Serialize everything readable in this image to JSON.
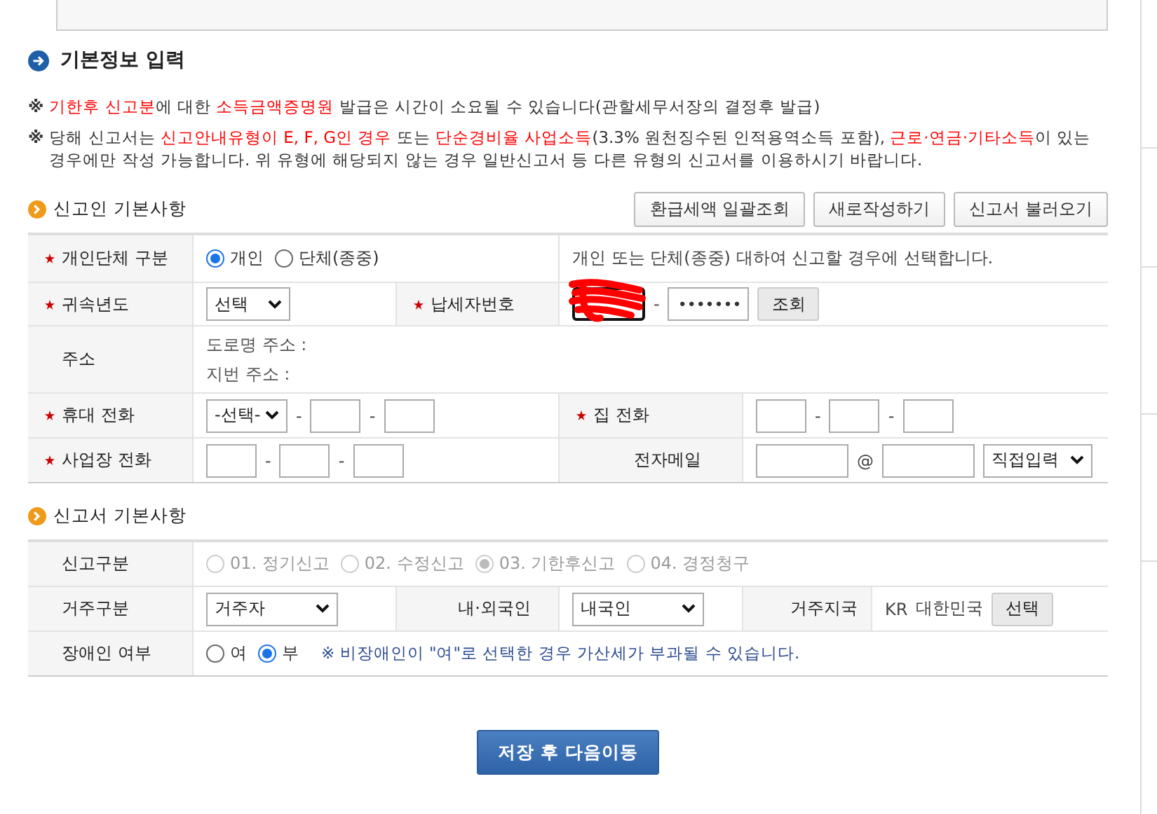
{
  "page_title": "기본정보 입력",
  "notices": [
    [
      {
        "text": "기한후 신고분",
        "highlight": true
      },
      {
        "text": "에 대한 ",
        "highlight": false
      },
      {
        "text": "소득금액증명원",
        "highlight": true
      },
      {
        "text": " 발급은 시간이 소요될 수 있습니다(관할세무서장의 결정후 발급)",
        "highlight": false
      }
    ],
    [
      {
        "text": "당해 신고서는 ",
        "highlight": false
      },
      {
        "text": "신고안내유형이 E, F, G인 경우",
        "highlight": true
      },
      {
        "text": " 또는 ",
        "highlight": false
      },
      {
        "text": "단순경비율 사업소득",
        "highlight": true
      },
      {
        "text": "(3.3% 원천징수된 인적용역소득 포함), ",
        "highlight": false
      },
      {
        "text": "근로·연금·기타소득",
        "highlight": true
      },
      {
        "text": "이 있는 경우에만 작성 가능합니다. 위 유형에 해당되지 않는 경우 일반신고서 등 다른 유형의 신고서를 이용하시기 바랍니다.",
        "highlight": false
      }
    ]
  ],
  "notice_mark": "※",
  "sections": [
    {
      "title": "신고인 기본사항",
      "buttons": [
        "환급세액 일괄조회",
        "새로작성하기",
        "신고서 불러오기"
      ],
      "rows": [
        {
          "fields": [
            {
              "label": "개인단체 구분",
              "required": true,
              "items": [
                {
                  "kind": "radio",
                  "label": "개인",
                  "selected": true,
                  "disabled": false
                },
                {
                  "kind": "radio",
                  "label": "단체(종중)",
                  "selected": false,
                  "disabled": false
                }
              ],
              "hint": "개인 또는 단체(종중) 대하여 신고할 경우에 선택합니다."
            }
          ]
        },
        {
          "fields": [
            {
              "label": "귀속년도",
              "required": true,
              "items": [
                {
                  "kind": "select",
                  "value": "선택"
                }
              ]
            },
            {
              "label": "납세자번호",
              "required": true,
              "items": [
                {
                  "kind": "redacted"
                },
                {
                  "kind": "sep",
                  "text": "-"
                },
                {
                  "kind": "input",
                  "value": "•••••••"
                },
                {
                  "kind": "button",
                  "label": "조회"
                }
              ]
            }
          ]
        },
        {
          "fields": [
            {
              "label": "주소",
              "required": false,
              "items": [
                {
                  "kind": "line",
                  "text": "도로명 주소 :"
                },
                {
                  "kind": "line",
                  "text": "지번 주소 :"
                }
              ]
            }
          ]
        },
        {
          "fields": [
            {
              "label": "휴대 전화",
              "required": true,
              "items": [
                {
                  "kind": "select",
                  "value": "-선택-"
                },
                {
                  "kind": "sep",
                  "text": "-"
                },
                {
                  "kind": "input",
                  "value": ""
                },
                {
                  "kind": "sep",
                  "text": "-"
                },
                {
                  "kind": "input",
                  "value": ""
                }
              ]
            },
            {
              "label": "집 전화",
              "required": true,
              "items": [
                {
                  "kind": "input",
                  "value": ""
                },
                {
                  "kind": "sep",
                  "text": "-"
                },
                {
                  "kind": "input",
                  "value": ""
                },
                {
                  "kind": "sep",
                  "text": "-"
                },
                {
                  "kind": "input",
                  "value": ""
                }
              ]
            }
          ]
        },
        {
          "fields": [
            {
              "label": "사업장 전화",
              "required": true,
              "items": [
                {
                  "kind": "input",
                  "value": ""
                },
                {
                  "kind": "sep",
                  "text": "-"
                },
                {
                  "kind": "input",
                  "value": ""
                },
                {
                  "kind": "sep",
                  "text": "-"
                },
                {
                  "kind": "input",
                  "value": ""
                }
              ]
            },
            {
              "label": "전자메일",
              "required": false,
              "items": [
                {
                  "kind": "wideinput",
                  "value": ""
                },
                {
                  "kind": "sep",
                  "text": "@"
                },
                {
                  "kind": "wideinput",
                  "value": ""
                },
                {
                  "kind": "select",
                  "value": "직접입력"
                }
              ]
            }
          ]
        }
      ]
    },
    {
      "title": "신고서 기본사항",
      "rows": [
        {
          "fields": [
            {
              "label": "신고구분",
              "required": false,
              "items": [
                {
                  "kind": "radio",
                  "label": "01. 정기신고",
                  "selected": false,
                  "disabled": true
                },
                {
                  "kind": "radio",
                  "label": "02. 수정신고",
                  "selected": false,
                  "disabled": true
                },
                {
                  "kind": "radio",
                  "label": "03. 기한후신고",
                  "selected": true,
                  "disabled": true
                },
                {
                  "kind": "radio",
                  "label": "04. 경정청구",
                  "selected": false,
                  "disabled": true
                }
              ]
            }
          ]
        },
        {
          "fields": [
            {
              "label": "거주구분",
              "required": false,
              "items": [
                {
                  "kind": "select",
                  "value": "거주자"
                }
              ]
            },
            {
              "label": "내·외국인",
              "required": false,
              "items": [
                {
                  "kind": "select",
                  "value": "내국인"
                }
              ]
            },
            {
              "label": "거주지국",
              "required": false,
              "items": [
                {
                  "kind": "text",
                  "text": "KR"
                },
                {
                  "kind": "text",
                  "text": "대한민국"
                },
                {
                  "kind": "button",
                  "label": "선택"
                }
              ]
            }
          ]
        },
        {
          "fields": [
            {
              "label": "장애인 여부",
              "required": false,
              "items": [
                {
                  "kind": "radio",
                  "label": "여",
                  "selected": false,
                  "disabled": false
                },
                {
                  "kind": "radio",
                  "label": "부",
                  "selected": true,
                  "disabled": false
                },
                {
                  "kind": "note",
                  "text": "※ 비장애인이 \"여\"로 선택한 경우 가산세가 부과될 수 있습니다."
                }
              ]
            }
          ]
        }
      ]
    }
  ],
  "submit": "저장 후 다음이동"
}
